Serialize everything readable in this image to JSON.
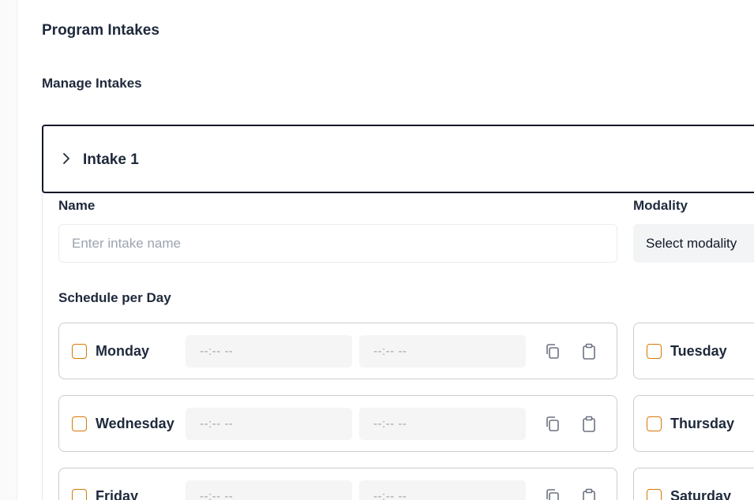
{
  "page": {
    "title": "Program Intakes",
    "section_title": "Manage Intakes"
  },
  "intake": {
    "title": "Intake 1",
    "name_label": "Name",
    "name_placeholder": "Enter intake name",
    "name_value": "",
    "modality_label": "Modality",
    "modality_selected": "Select modality",
    "schedule_label": "Schedule per Day"
  },
  "days": [
    {
      "name": "Monday",
      "start_placeholder": "--:-- --",
      "end_placeholder": "--:-- --",
      "checked": false
    },
    {
      "name": "Tuesday",
      "start_placeholder": "--:-- --",
      "end_placeholder": "--:-- --",
      "checked": false
    },
    {
      "name": "Wednesday",
      "start_placeholder": "--:-- --",
      "end_placeholder": "--:-- --",
      "checked": false
    },
    {
      "name": "Thursday",
      "start_placeholder": "--:-- --",
      "end_placeholder": "--:-- --",
      "checked": false
    },
    {
      "name": "Friday",
      "start_placeholder": "--:-- --",
      "end_placeholder": "--:-- --",
      "checked": false
    },
    {
      "name": "Saturday",
      "start_placeholder": "--:-- --",
      "end_placeholder": "--:-- --",
      "checked": false
    }
  ],
  "icons": {
    "expand": "chevron-right-icon",
    "copy": "copy-icon",
    "paste": "clipboard-icon"
  },
  "colors": {
    "checkbox_border": "#d97706",
    "header_border": "#111827",
    "text": "#1e293b"
  }
}
